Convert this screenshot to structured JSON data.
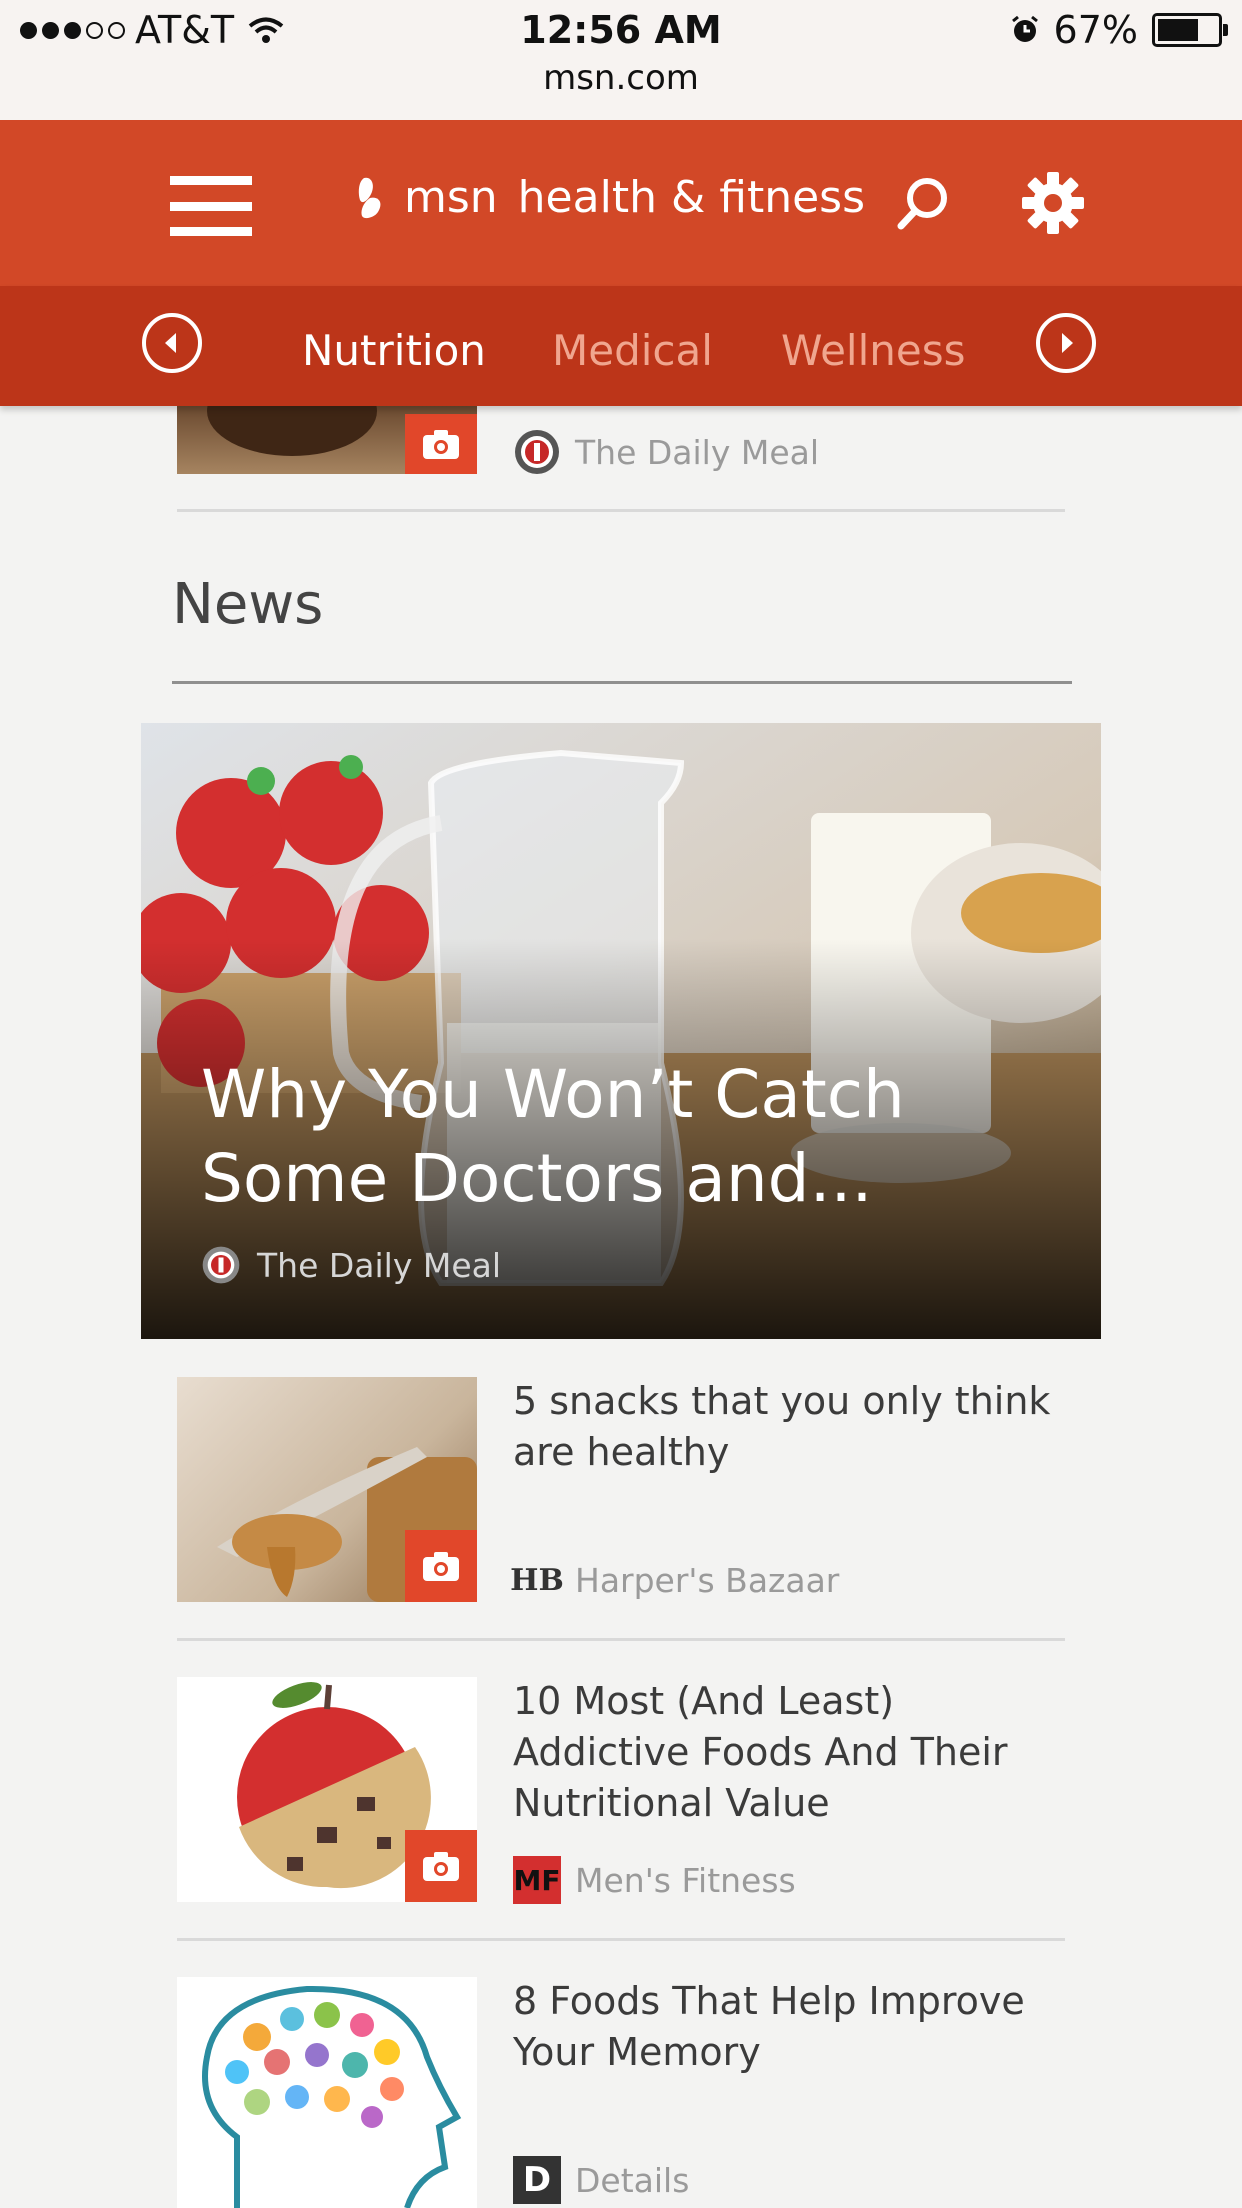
{
  "status_bar": {
    "carrier": "AT&T",
    "time": "12:56 AM",
    "url": "msn.com",
    "battery": "67%"
  },
  "header": {
    "brand": "msn",
    "section": "health & fitness"
  },
  "tabs": [
    {
      "label": "Nutrition",
      "active": true
    },
    {
      "label": "Medical",
      "active": false
    },
    {
      "label": "Wellness",
      "active": false
    }
  ],
  "partial_article": {
    "source": "The Daily Meal"
  },
  "news": {
    "title": "News",
    "hero": {
      "title": "Why You Won’t Catch Some Doctors and...",
      "source": "The Daily Meal"
    },
    "items": [
      {
        "title": "5 snacks that you only think are healthy",
        "source": "Harper's Bazaar",
        "logo": "HB"
      },
      {
        "title": "10 Most (And Least) Addictive Foods And Their Nutritional Value",
        "source": "Men's Fitness",
        "logo": "MF"
      },
      {
        "title": "8 Foods That Help Improve Your Memory",
        "source": "Details",
        "logo": "D"
      }
    ]
  },
  "colors": {
    "header": "#d24827",
    "subnav": "#bc3519",
    "camera_badge": "#e1472a"
  }
}
